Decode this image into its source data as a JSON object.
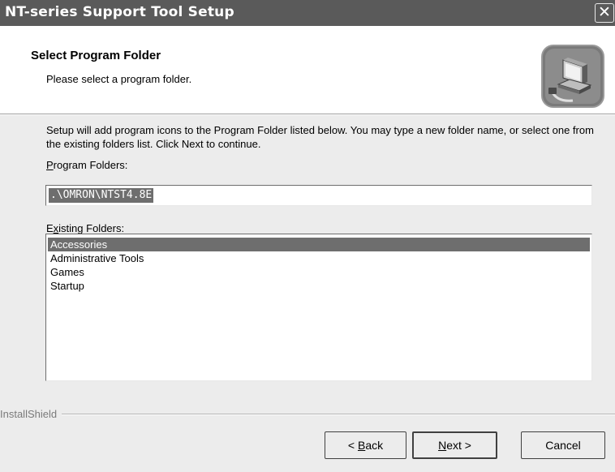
{
  "window": {
    "title": "NT-series Support Tool Setup",
    "close_glyph": "✕"
  },
  "header": {
    "title": "Select Program Folder",
    "subtitle": "Please select a program folder.",
    "icon": "installer-computer-icon"
  },
  "body": {
    "description": "Setup will add program icons to the Program Folder listed below.  You may type a new folder name, or select one from the existing folders list.  Click Next to continue.",
    "program_folders_label": {
      "mnemonic": "P",
      "rest": "rogram Folders:"
    },
    "program_folder_value": ".\\OMRON\\NTST4.8E",
    "existing_folders_label": {
      "before": "E",
      "mnemonic": "x",
      "rest": "isting Folders:"
    },
    "existing_folders": [
      "Accessories",
      "Administrative Tools",
      "Games",
      "Startup"
    ],
    "selected_folder": "Accessories"
  },
  "footer": {
    "brand": "InstallShield",
    "back": {
      "prefix": "< ",
      "mnemonic": "B",
      "rest": "ack"
    },
    "next": {
      "mnemonic": "N",
      "rest": "ext >"
    },
    "cancel": "Cancel"
  },
  "colors": {
    "titlebar": "#5a5a5a",
    "selection": "#6e6e6e",
    "dialog_bg": "#ececec"
  }
}
